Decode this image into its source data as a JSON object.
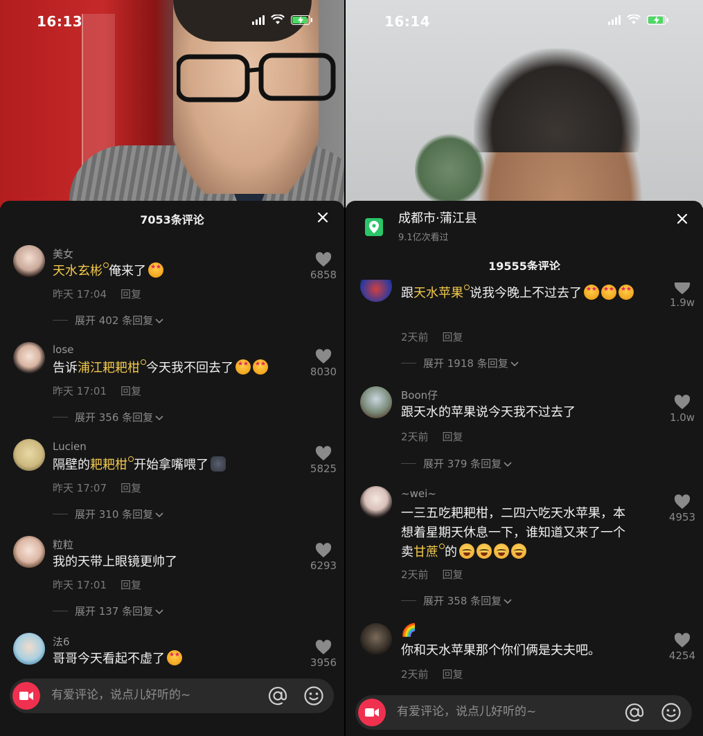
{
  "left": {
    "status_time": "16:13",
    "comments_title": "7053条评论",
    "input_placeholder": "有爱评论，说点儿好听的~",
    "comments": [
      {
        "user": "美女",
        "text_parts": [
          {
            "t": "天水玄彬",
            "hl": true
          },
          {
            "t": "俺来了"
          }
        ],
        "emoji": [
          "star-eyes"
        ],
        "time": "昨天 17:04",
        "reply": "回复",
        "expand": "展开 402 条回复",
        "likes": "6858"
      },
      {
        "user": "lose",
        "text_parts": [
          {
            "t": "告诉"
          },
          {
            "t": "浦江耙耙柑",
            "hl": true
          },
          {
            "t": "今天我不回去了"
          }
        ],
        "emoji": [
          "star-eyes",
          "star-eyes"
        ],
        "time": "昨天 17:01",
        "reply": "回复",
        "expand": "展开 356 条回复",
        "likes": "8030"
      },
      {
        "user": "Lucien",
        "text_parts": [
          {
            "t": "隔壁的"
          },
          {
            "t": "耙耙柑",
            "hl": true
          },
          {
            "t": "开始拿嘴喂了"
          }
        ],
        "emoji": [
          "cat"
        ],
        "time": "昨天 17:07",
        "reply": "回复",
        "expand": "展开 310 条回复",
        "likes": "5825"
      },
      {
        "user": "粒粒",
        "text_parts": [
          {
            "t": "我的天带上眼镜更帅了"
          }
        ],
        "emoji": [],
        "time": "昨天 17:01",
        "reply": "回复",
        "expand": "展开 137 条回复",
        "likes": "6293"
      },
      {
        "user": "法6",
        "text_parts": [
          {
            "t": "哥哥今天看起不虚了"
          }
        ],
        "emoji": [
          "star-eyes"
        ],
        "time": "",
        "reply": "",
        "expand": "",
        "likes": "3956"
      }
    ]
  },
  "right": {
    "status_time": "16:14",
    "location_name": "成都市·蒲江县",
    "location_views": "9.1亿次看过",
    "comments_title": "19555条评论",
    "input_placeholder": "有爱评论，说点儿好听的~",
    "comments": [
      {
        "user": "",
        "line1": [
          {
            "t": "跟"
          },
          {
            "t": "天水苹果",
            "hl": true
          },
          {
            "t": "说我今晚上不过去了"
          }
        ],
        "emoji": [
          "star-eyes",
          "star-eyes",
          "star-eyes"
        ],
        "time": "2天前",
        "reply": "回复",
        "expand": "展开 1918 条回复",
        "likes": "1.9w"
      },
      {
        "user": "Boon仔",
        "text": "跟天水的苹果说今天我不过去了",
        "time": "2天前",
        "reply": "回复",
        "expand": "展开 379 条回复",
        "likes": "1.0w"
      },
      {
        "user": "~wei~",
        "line1": "一三五吃耙耙柑，二四六吃天水苹果，本",
        "line2": "想着星期天休息一下，谁知道又来了一个",
        "line3_parts": [
          {
            "t": "卖"
          },
          {
            "t": "甘蔗",
            "hl": true
          },
          {
            "t": "的"
          }
        ],
        "emoji": [
          "cry",
          "cry",
          "cry",
          "cry"
        ],
        "time": "2天前",
        "reply": "回复",
        "expand": "展开 358 条回复",
        "likes": "4953"
      },
      {
        "user": "🌈",
        "text": "你和天水苹果那个你们俩是夫夫吧。",
        "time": "2天前",
        "reply": "回复",
        "likes": "4254"
      }
    ]
  },
  "colors": {
    "highlight": "#f2c94c",
    "camera_button": "#f0304f",
    "location_green": "#2bc56a",
    "sheet_bg": "#161616"
  },
  "icons": [
    "signal-icon",
    "wifi-icon",
    "battery-charging-icon",
    "close-icon",
    "heart-icon",
    "chevron-down-icon",
    "camera-icon",
    "at-icon",
    "smile-icon",
    "location-pin-icon"
  ]
}
